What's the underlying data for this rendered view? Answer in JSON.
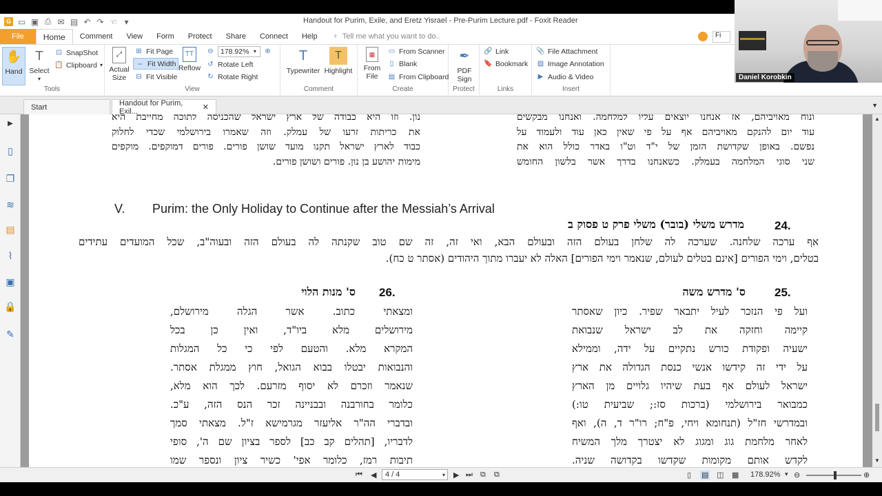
{
  "window": {
    "title": "Handout for Purim, Exile, and Eretz Yisrael - Pre-Purim Lecture.pdf - Foxit Reader"
  },
  "menubar": {
    "file": "File",
    "home": "Home",
    "comment": "Comment",
    "view": "View",
    "form": "Form",
    "protect": "Protect",
    "share": "Share",
    "connect": "Connect",
    "help": "Help",
    "tellme_placeholder": "Tell me what you want to do.."
  },
  "ribbon": {
    "tools": {
      "label": "Tools",
      "hand": "Hand",
      "select": "Select",
      "snapshot": "SnapShot",
      "clipboard": "Clipboard"
    },
    "view": {
      "label": "View",
      "actual": "Actual",
      "size": "Size",
      "fit_page": "Fit Page",
      "fit_width": "Fit Width",
      "fit_visible": "Fit Visible",
      "reflow": "Reflow",
      "zoom": "178.92%",
      "rotate_left": "Rotate Left",
      "rotate_right": "Rotate Right"
    },
    "comment": {
      "label": "Comment",
      "typewriter": "Typewriter",
      "highlight": "Highlight"
    },
    "create": {
      "label": "Create",
      "from": "From",
      "file": "File",
      "from_scanner": "From Scanner",
      "blank": "Blank",
      "from_clipboard": "From Clipboard"
    },
    "protect": {
      "label": "Protect",
      "pdf": "PDF",
      "sign": "Sign"
    },
    "links": {
      "label": "Links",
      "link": "Link",
      "bookmark": "Bookmark"
    },
    "insert": {
      "label": "Insert",
      "file_attachment": "File Attachment",
      "image_annotation": "Image Annotation",
      "audio_video": "Audio & Video"
    }
  },
  "video": {
    "name": "Daniel Korobkin"
  },
  "tabs": {
    "start": "Start",
    "doc": "Handout for Purim, Exil..."
  },
  "document": {
    "top_left_lines": [
      "נון. וזו היא כבודה של ארץ ישראל שהכניסה לתוכה מחייבת היא",
      "את כריתות זרעו של עמלק. וזה שאמרו בירושלמי שכדי לחלוק",
      "כבוד לארץ ישראל תקנו מועד שושן פורים. פורים דמוקפים. מוקפים",
      "מימות יהושע בן נון. פורים ושושן פורים."
    ],
    "top_right_lines": [
      "ונוח מאויביהם, אז אנחנו יוצאים עליו למלחמה. ואנחנו מבקשים",
      "עוד יום להנקם מאויביהם אף על פי שאין כאן עוד ולעמוד על",
      "נפשם. באופן שקדושת הזמן של י\"ד וט\"ו באדר כולל הוא את",
      "שני סוגי המלחמה בעמלק. כשאנחנו בדרך אשר בלשון החומש"
    ],
    "section_num": "V.",
    "section_title": "Purim: the Only Holiday to Continue after the Messiah’s Arrival",
    "s24": {
      "num": "24.",
      "title": "מדרש משלי (בובר) משלי פרק ט פסוק ב",
      "line1": "אף ערכה שלחנה. שערכה לה שלחן בעולם הזה ובעולם הבא, ואי זה, זה שם טוב שקנתה לה בעולם הזה ובעוה\"ב, שכל המועדים עתידים",
      "line2": "בטלים, וימי הפורים [אינם בטלים לעולם, שנאמר וימי הפורים] האלה לא יעברו מתוך היהודים (אסתר ט כח)."
    },
    "s26": {
      "num": "26.",
      "title": "ס' מנות הלוי",
      "lines": [
        "ומצאתי כתוב. אשר הגלה מירושלם,",
        "מירושלים מלא ביו\"ד, ואין כן בכל",
        "המקרא מלא. והטעם לפי כי כל המגלות",
        "והנבואות יבטלו בבוא הגואל, חוץ ממגלת אסתר.",
        "שנאמר וזכרם לא יסוף מזרעם. לכך הוא מלא,",
        "כלומר בחורבנה ובבניינה זכר הנס הזה, ע\"כ.",
        "ובדברי הה\"ר אליעזר מגרמישא ז\"ל. מצאתי סמך",
        "לדבריו, [תהלים קב כב] לספר בציון שם ה', סופי",
        "תיבות רמז, כלומר אפי' כשיר ציון ונספר שמו"
      ]
    },
    "s25": {
      "num": "25.",
      "title": "ס' מדרש משה",
      "lines": [
        "ועל פי הנזכר לעיל יתבאר שפיר. כיון שאסתר",
        "קיימה וחזקה את לב ישראל שנבואת",
        "ישעיה ופקודת כורש נתקיים על ידה, וממילא",
        "על ידי זה קידשו אנשי כנסת הגדולה את ארץ",
        "ישראל לעולם אף בעת שיהיו גלויים מן הארץ",
        "כמבואר בירושלמי (ברכות סז:; שביעית טו:)",
        "ובמדרשי חז\"ל (תנחומא ויחי, פ\"ח; רו\"ר ד, ה), ואף",
        "לאחר מלחמת גוג ומגוג לא יצטרך מלך המשיח",
        "לקדש אותם מקומות שקדשו בקדושה שניה."
      ]
    }
  },
  "status": {
    "page": "4 / 4",
    "zoom": "178.92%"
  }
}
